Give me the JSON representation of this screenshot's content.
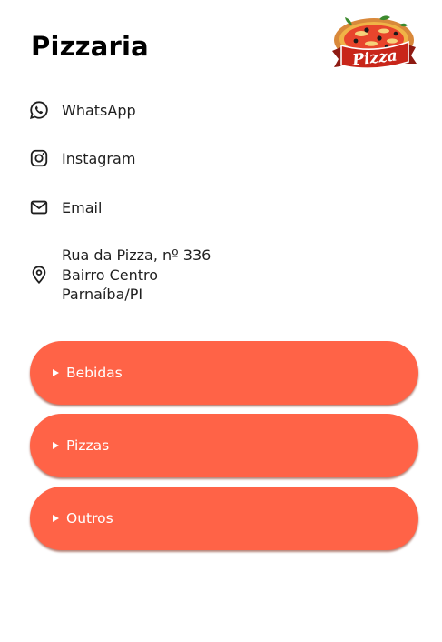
{
  "header": {
    "title": "Pizzaria",
    "logo_text": "Pizza",
    "logo_icon": "pizza-logo-icon"
  },
  "contacts": [
    {
      "label": "WhatsApp",
      "icon": "whatsapp-icon"
    },
    {
      "label": "Instagram",
      "icon": "instagram-icon"
    },
    {
      "label": "Email",
      "icon": "email-icon"
    }
  ],
  "address": {
    "icon": "location-pin-icon",
    "lines": [
      "Rua da Pizza, nº 336",
      "Bairro Centro",
      "Parnaíba/PI"
    ]
  },
  "menu": {
    "items": [
      {
        "label": "Bebidas",
        "expanded": false
      },
      {
        "label": "Pizzas",
        "expanded": false
      },
      {
        "label": "Outros",
        "expanded": false
      }
    ]
  },
  "colors": {
    "accent": "#ff6347",
    "text": "#1f1f1f",
    "title": "#000000",
    "button_text": "#ffffff"
  }
}
